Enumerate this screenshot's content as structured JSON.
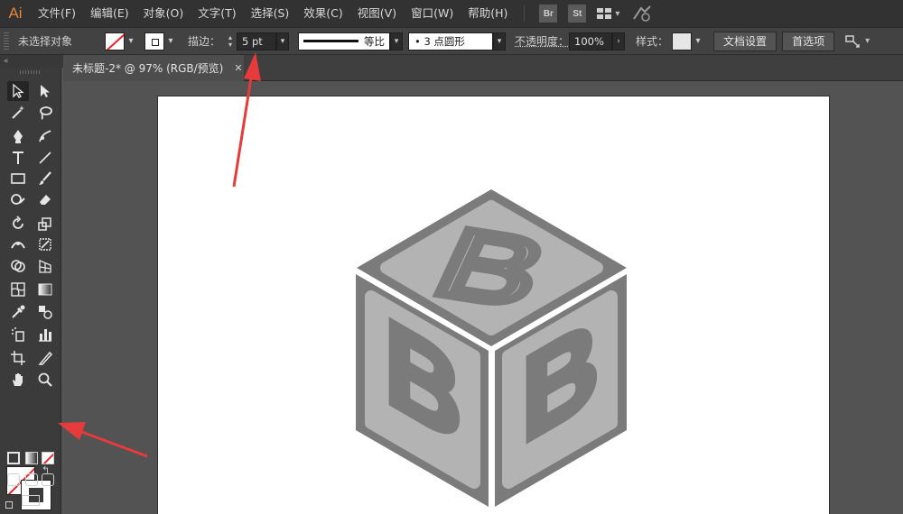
{
  "app": {
    "logo": "Ai"
  },
  "menu": {
    "items": [
      "文件(F)",
      "编辑(E)",
      "对象(O)",
      "文字(T)",
      "选择(S)",
      "效果(C)",
      "视图(V)",
      "窗口(W)",
      "帮助(H)"
    ],
    "bridge": "Br",
    "stock": "St"
  },
  "control": {
    "selection_status": "未选择对象",
    "stroke_label": "描边：",
    "stroke_weight": "5 pt",
    "stroke_profile": "等比",
    "brush": "•  3 点圆形",
    "opacity_label": "不透明度：",
    "opacity_value": "100%",
    "style_label": "样式：",
    "doc_setup_button": "文档设置",
    "preferences_button": "首选项"
  },
  "panel": {
    "collapse": "«"
  },
  "document": {
    "tab_title": "未标题-2* @ 97% (RGB/预览)",
    "close": "✕"
  },
  "artwork": {
    "letter": "B",
    "colors": {
      "dark": "#7b7b7b",
      "light": "#b3b3b3",
      "accent_arrow": "#e53b3b",
      "highlight_brand": "#e8863a"
    }
  }
}
